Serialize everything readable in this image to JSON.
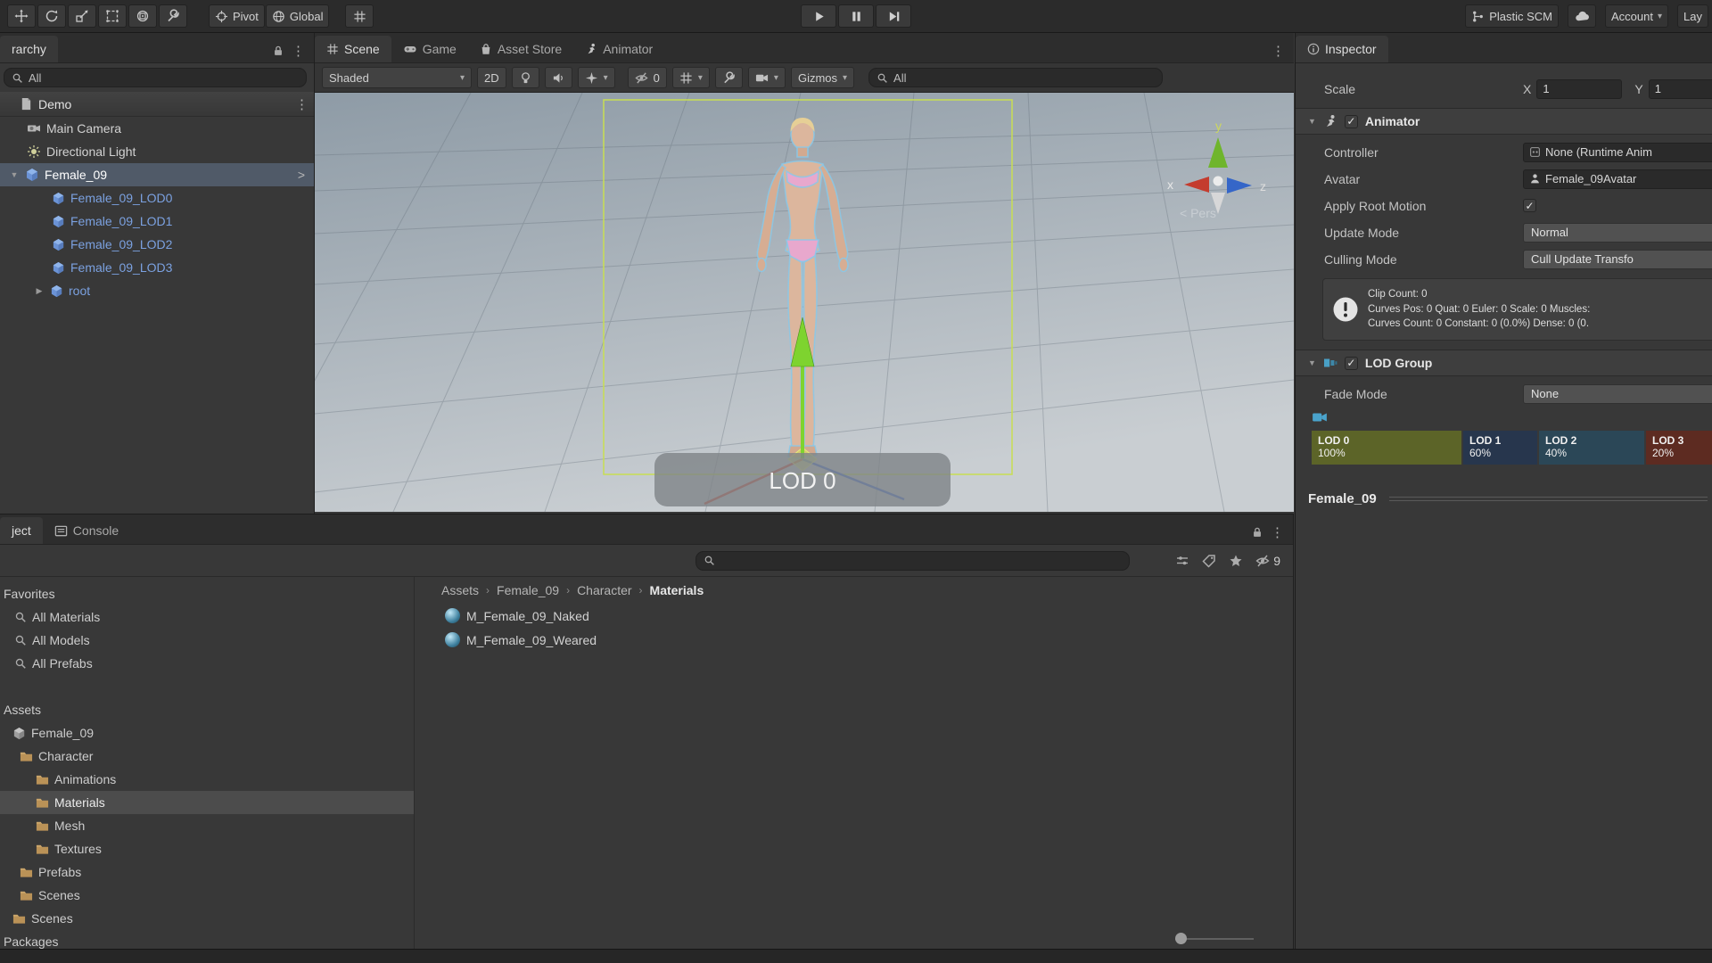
{
  "top_toolbar": {
    "pivot_label": "Pivot",
    "global_label": "Global",
    "plastic_label": "Plastic SCM",
    "account_label": "Account",
    "layers_label": "Lay"
  },
  "hierarchy": {
    "tab_label": "rarchy",
    "search_value": "All",
    "scene_name": "Demo",
    "items": {
      "camera": "Main Camera",
      "light": "Directional Light",
      "female": "Female_09",
      "lod0": "Female_09_LOD0",
      "lod1": "Female_09_LOD1",
      "lod2": "Female_09_LOD2",
      "lod3": "Female_09_LOD3",
      "root": "root"
    }
  },
  "scene_view": {
    "tabs": {
      "scene": "Scene",
      "game": "Game",
      "asset_store": "Asset Store",
      "animator": "Animator"
    },
    "toolbar": {
      "shading": "Shaded",
      "mode_2d": "2D",
      "hidden_count": "0",
      "gizmos": "Gizmos",
      "search_value": "All"
    },
    "viewport": {
      "lod_badge": "LOD 0",
      "persp": "< Pers",
      "axis_x": "x",
      "axis_y": "y",
      "axis_z": "z"
    }
  },
  "project": {
    "tab_project": "ject",
    "tab_console": "Console",
    "toolbar_hidden_count": "9",
    "favorites_label": "Favorites",
    "fav_materials": "All Materials",
    "fav_models": "All Models",
    "fav_prefabs": "All Prefabs",
    "assets_label": "Assets",
    "tree": {
      "female": "Female_09",
      "character": "Character",
      "animations": "Animations",
      "materials": "Materials",
      "mesh": "Mesh",
      "textures": "Textures",
      "prefabs": "Prefabs",
      "scenes1": "Scenes",
      "scenes2": "Scenes",
      "packages": "Packages"
    },
    "breadcrumb": {
      "b0": "Assets",
      "b1": "Female_09",
      "b2": "Character",
      "b3": "Materials"
    },
    "files": {
      "f0": "M_Female_09_Naked",
      "f1": "M_Female_09_Weared"
    }
  },
  "inspector": {
    "tab_label": "Inspector",
    "scale": {
      "label": "Scale",
      "x_label": "X",
      "x_value": "1",
      "y_label": "Y",
      "y_value": "1"
    },
    "animator": {
      "title": "Animator",
      "controller_label": "Controller",
      "controller_value": "None (Runtime Anim",
      "avatar_label": "Avatar",
      "avatar_value": "Female_09Avatar",
      "root_motion_label": "Apply Root Motion",
      "update_mode_label": "Update Mode",
      "update_mode_value": "Normal",
      "culling_mode_label": "Culling Mode",
      "culling_mode_value": "Cull Update Transfo",
      "info_line1": "Clip Count: 0",
      "info_line2": "Curves Pos: 0 Quat: 0 Euler: 0 Scale: 0 Muscles:",
      "info_line3": "Curves Count: 0 Constant: 0 (0.0%) Dense: 0 (0."
    },
    "lod_group": {
      "title": "LOD Group",
      "fade_label": "Fade Mode",
      "fade_value": "None",
      "lods": [
        {
          "name": "LOD 0",
          "pct": "100%",
          "color": "#5c6428"
        },
        {
          "name": "LOD 1",
          "pct": "60%",
          "color": "#27364d"
        },
        {
          "name": "LOD 2",
          "pct": "40%",
          "color": "#2b4757"
        },
        {
          "name": "LOD 3",
          "pct": "20%",
          "color": "#5d2b21"
        }
      ]
    },
    "preview_title": "Female_09"
  }
}
